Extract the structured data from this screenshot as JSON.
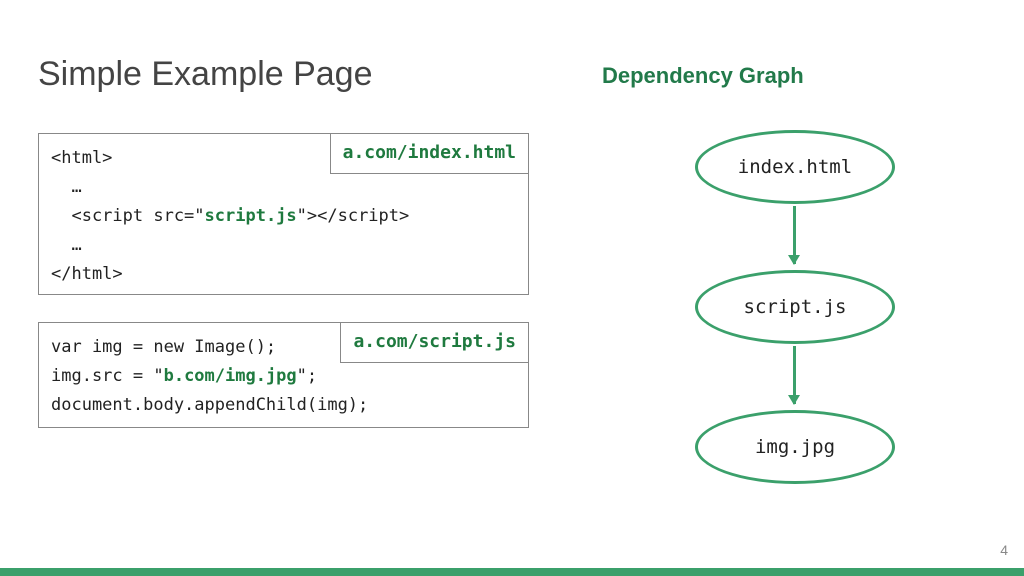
{
  "title": "Simple Example Page",
  "graph_title": "Dependency Graph",
  "page_number": "4",
  "code_box_1": {
    "label": "a.com/index.html",
    "lines": {
      "l1": "<html>",
      "l2": "  …",
      "l3a": "  <script src=\"",
      "l3b": "script.js",
      "l3c": "\"></script>",
      "l4": "  …",
      "l5": "</html>"
    }
  },
  "code_box_2": {
    "label": "a.com/script.js",
    "lines": {
      "l1": "var img = new Image();",
      "l2a": "img.src = \"",
      "l2b": "b.com/img.jpg",
      "l2c": "\";",
      "l3": "document.body.appendChild(img);"
    }
  },
  "graph": {
    "node1": "index.html",
    "node2": "script.js",
    "node3": "img.jpg"
  }
}
